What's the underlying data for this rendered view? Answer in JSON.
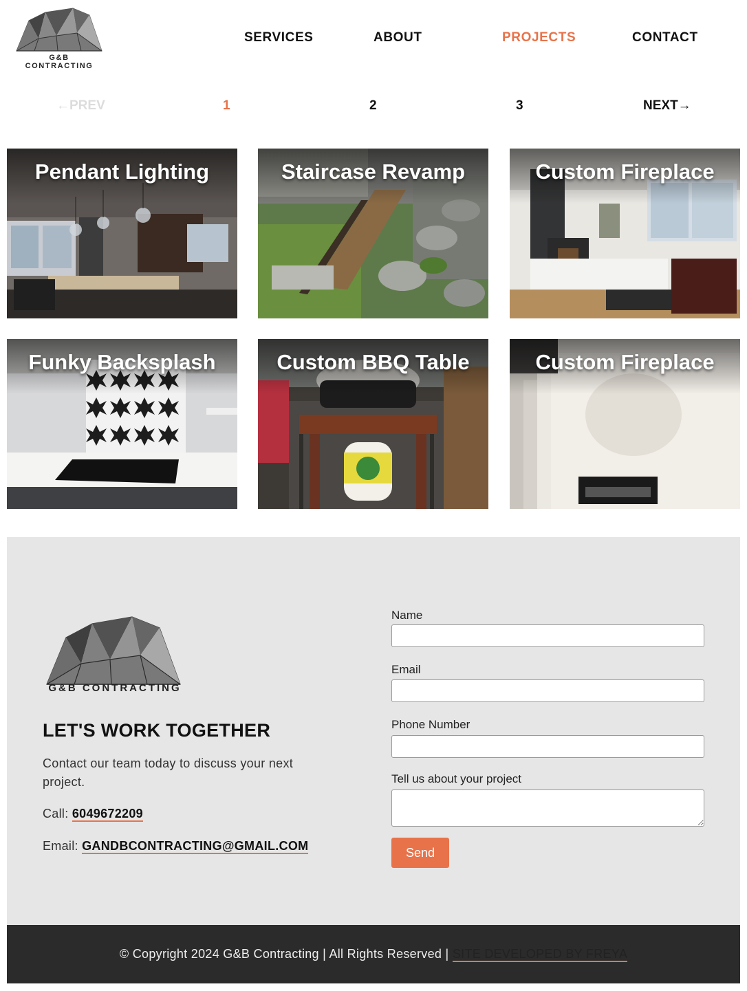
{
  "brand": {
    "name": "G&B CONTRACTING",
    "accent": "#e8734a",
    "text_color": "#111111"
  },
  "nav": {
    "items": [
      {
        "label": "SERVICES",
        "active": false
      },
      {
        "label": "ABOUT",
        "active": false
      },
      {
        "label": "PROJECTS",
        "active": true
      },
      {
        "label": "CONTACT",
        "active": false
      }
    ]
  },
  "pagination": {
    "prev": "←PREV",
    "pages": [
      "1",
      "2",
      "3"
    ],
    "current": "1",
    "next": "NEXT→"
  },
  "projects": [
    {
      "title": "Pendant Lighting",
      "icon": "kitchen-photo"
    },
    {
      "title": "Staircase Revamp",
      "icon": "staircase-photo"
    },
    {
      "title": "Custom Fireplace",
      "icon": "living-room-photo"
    },
    {
      "title": "Funky Backsplash",
      "icon": "backsplash-photo"
    },
    {
      "title": "Custom BBQ Table",
      "icon": "bbq-photo"
    },
    {
      "title": "Custom Fireplace",
      "icon": "fireplace-wall-photo"
    }
  ],
  "contact": {
    "logo_text": "G&B CONTRACTING",
    "heading": "LET'S WORK TOGETHER",
    "intro": "Contact our team today to discuss your next project.",
    "call_label": "Call:",
    "phone": "6049672209",
    "email_label": "Email:",
    "email": "GANDBCONTRACTING@GMAIL.COM",
    "form": {
      "name_label": "Name",
      "email_label": "Email",
      "phone_label": "Phone Number",
      "project_label": "Tell us about your project",
      "send_label": "Send"
    }
  },
  "footer": {
    "copyright": "© Copyright 2024 G&B Contracting | All Rights Reserved |",
    "credit": "SITE DEVELOPED BY FREYA"
  }
}
